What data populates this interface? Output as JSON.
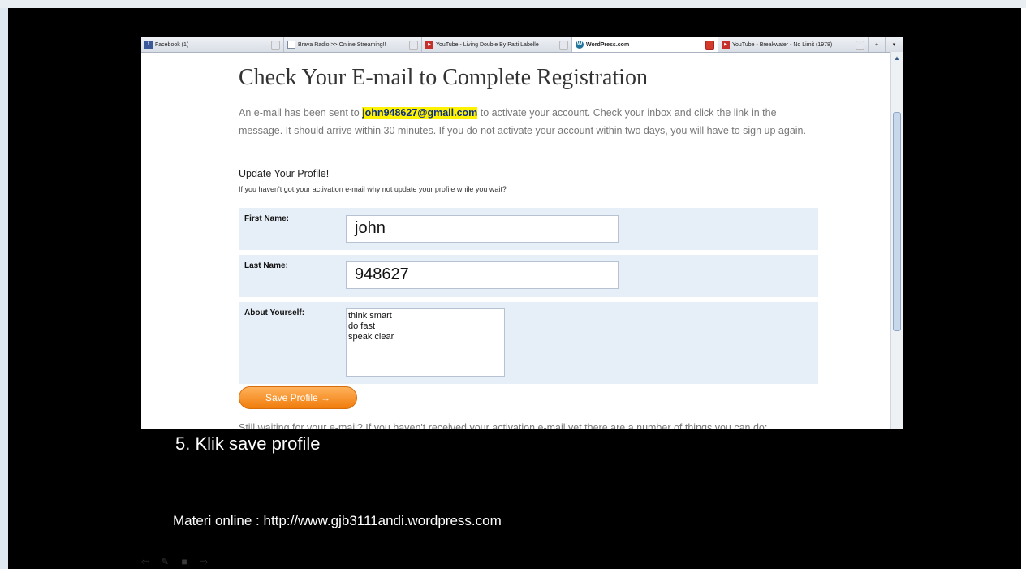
{
  "browser": {
    "tabs": [
      {
        "label": "Facebook (1)",
        "icon": "facebook-icon"
      },
      {
        "label": "Brava Radio >> Online Streaming!!",
        "icon": "page-icon"
      },
      {
        "label": "YouTube - Living Double By Patti Labelle",
        "icon": "youtube-icon"
      },
      {
        "label": "WordPress.com",
        "icon": "wordpress-icon"
      },
      {
        "label": "YouTube - Breakwater - No Limit (1978)",
        "icon": "youtube-icon"
      }
    ],
    "new_tab_symbol": "+",
    "tab_list_symbol": "▾",
    "scroll_up_symbol": "▲"
  },
  "page": {
    "title": "Check Your E-mail to Complete Registration",
    "message_before": "An e-mail has been sent to ",
    "email": "john948627@gmail.com",
    "message_after": " to activate your account. Check your inbox and click the link in the message. It should arrive within 30 minutes. If you do not activate your account within two days, you will have to sign up again.",
    "update_heading": "Update Your Profile!",
    "update_sub": "If you haven't got your activation e-mail why not update your profile while you wait?",
    "first_name_label": "First Name:",
    "first_name_value": "john",
    "last_name_label": "Last Name:",
    "last_name_value": "948627",
    "about_label": "About Yourself:",
    "about_value": "think smart\ndo fast\nspeak clear",
    "save_button": "Save Profile →",
    "cut_text": "Still waiting for your e-mail? If you haven't received your activation e-mail yet there are a number of things you can do:"
  },
  "slide": {
    "caption": "5. Klik save profile",
    "materi": "Materi online : http://www.gjb3111andi.wordpress.com"
  },
  "controls": {
    "prev_icon": "arrow-left-icon",
    "pen_icon": "pen-icon",
    "menu_icon": "menu-icon",
    "next_icon": "arrow-right-icon"
  },
  "colors": {
    "highlight": "#fff200",
    "email_text": "#0b2e8c",
    "save_button": "#f07d0c",
    "form_row_bg": "#e6eef7",
    "slide_bg": "#000000"
  }
}
